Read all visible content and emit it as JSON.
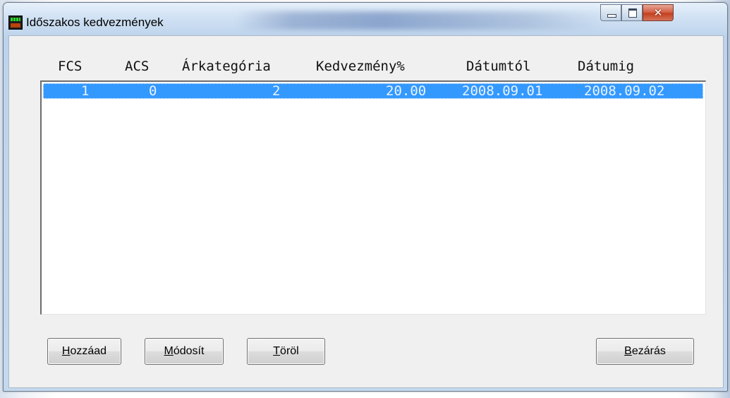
{
  "window": {
    "title": "Időszakos kedvezmények",
    "controls": {
      "minimize": "minimize-icon",
      "maximize": "maximize-icon",
      "close": "✕"
    }
  },
  "table": {
    "columns": [
      "FCS",
      "ACS",
      "Árkategória",
      "Kedvezmény%",
      "Dátumtól",
      "Dátumig"
    ],
    "rows": [
      {
        "fcs": "1",
        "acs": "0",
        "arkategoria": "2",
        "kedvezmeny": "20.00",
        "datumtol": "2008.09.01",
        "datumig": "2008.09.02",
        "selected": true
      }
    ]
  },
  "buttons": {
    "add": {
      "accel": "H",
      "rest": "ozzáad"
    },
    "modify": {
      "accel": "M",
      "rest": "ódosít"
    },
    "delete": {
      "accel": "T",
      "rest": "öröl"
    },
    "close": {
      "accel": "B",
      "rest": "ezárás"
    }
  },
  "colors": {
    "selection": "#3399ff",
    "close_button": "#c4401f"
  }
}
